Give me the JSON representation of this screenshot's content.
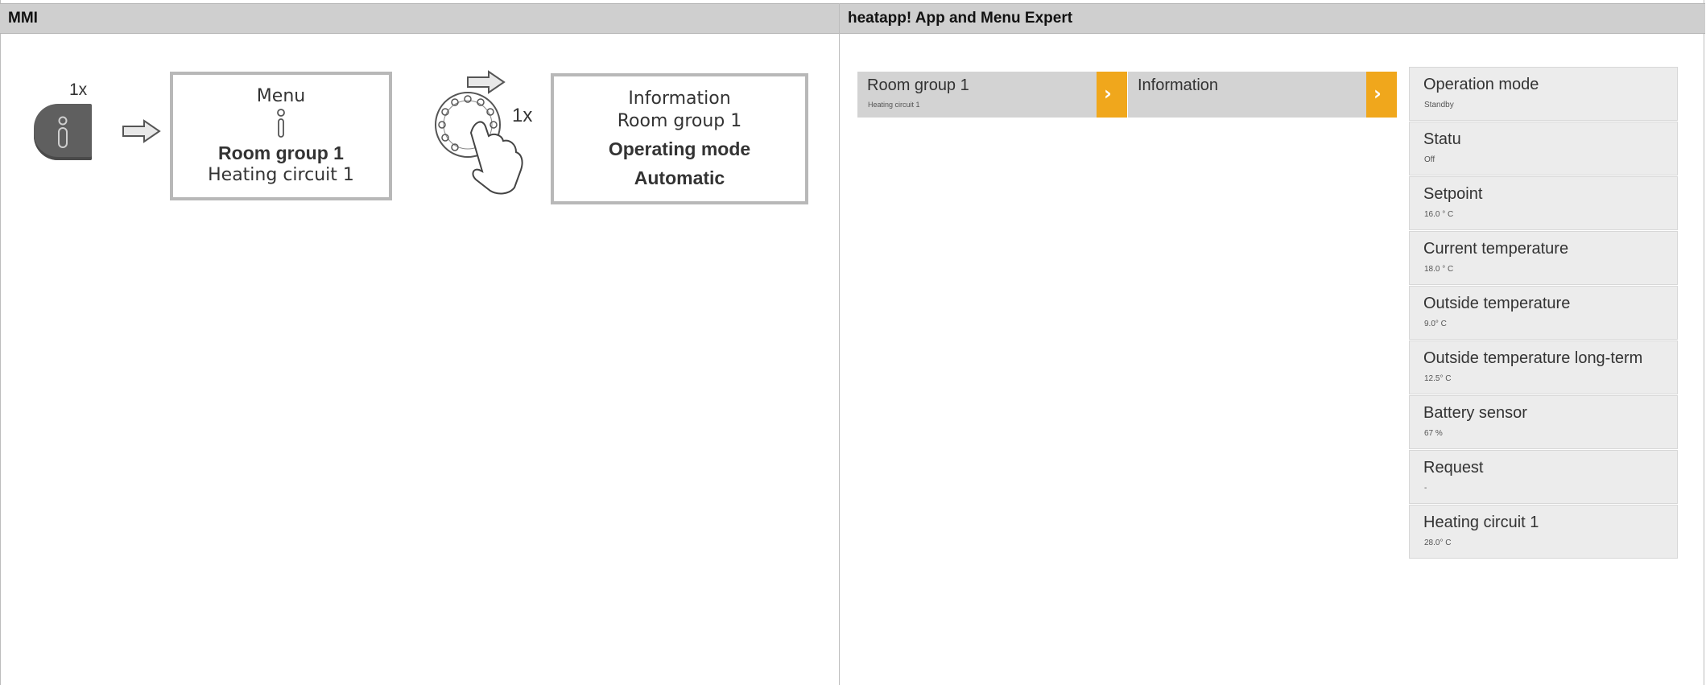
{
  "headers": {
    "left": "MMI",
    "right": "heatapp!  App and Menu Expert"
  },
  "mmi": {
    "press_count_button": "1x",
    "press_count_knob": "1x",
    "menu_box": {
      "line1": "Menu",
      "line2": "Room group 1",
      "line3": "Heating circuit 1"
    },
    "info_box": {
      "line1": "Information",
      "line2": "Room group 1",
      "line3": "Operating mode",
      "line4": "Automatic"
    }
  },
  "app": {
    "col1": {
      "title": "Room group 1",
      "sub": "Heating circuit 1"
    },
    "col2": {
      "title": "Information"
    },
    "items": [
      {
        "title": "Operation mode",
        "value": "Standby"
      },
      {
        "title": "Statu",
        "value": "Off"
      },
      {
        "title": "Setpoint",
        "value": "16.0 ° C"
      },
      {
        "title": "Current temperature",
        "value": "18.0 ° C"
      },
      {
        "title": "Outside temperature",
        "value": "9.0° C"
      },
      {
        "title": "Outside temperature long-term",
        "value": "12.5° C"
      },
      {
        "title": "Battery sensor",
        "value": "67 %"
      },
      {
        "title": "Request",
        "value": "-"
      },
      {
        "title": "Heating circuit 1",
        "value": "28.0° C"
      }
    ],
    "accent_color": "#f0a71c"
  }
}
